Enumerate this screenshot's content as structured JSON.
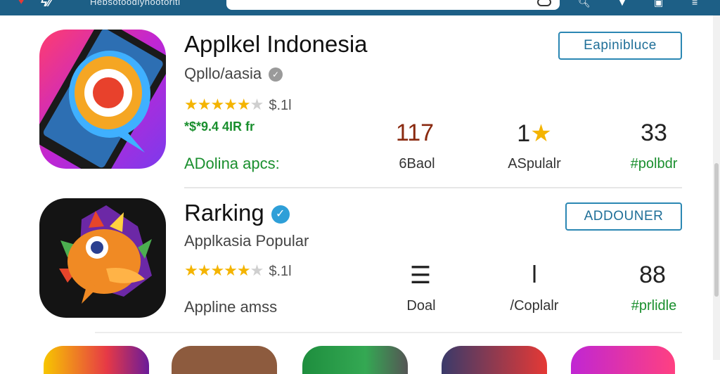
{
  "topbar": {
    "url_text": "Hebsotoodiynootoriti",
    "icons": [
      "heart-icon",
      "search-icon",
      "dropdown-icon",
      "window-icon",
      "menu-icon"
    ]
  },
  "apps": [
    {
      "name": "Applkel Indonesia",
      "subtitle": "Qpllo/aasia",
      "rating_value": "4.5",
      "rating_text": "$.1l",
      "green_line": "*$*9.4 4IR fr",
      "footer": "ADolina apcs:",
      "button": "Eapinibluce",
      "stats": [
        {
          "value": "117",
          "label": "6Baol",
          "value_color": "#8a2a10"
        },
        {
          "value": "1",
          "star": "★",
          "label": "ASpulalr",
          "value_color": "#222"
        },
        {
          "value": "33",
          "label": "#polbdr",
          "value_color": "#222",
          "label_color": "#1a8f2e"
        }
      ]
    },
    {
      "name": "Rarking",
      "subtitle": "Applkasia Popular",
      "rating_value": "4.5",
      "rating_text": "$.1l",
      "footer": "Appline amss",
      "button": "ADDOUNER",
      "stats": [
        {
          "value": "☰",
          "label": "Doal",
          "value_color": "#333"
        },
        {
          "value": "Ɩ",
          "label": "/Coplalr",
          "value_color": "#333"
        },
        {
          "value": "88",
          "label": "#prlidle",
          "value_color": "#222",
          "label_color": "#1a8f2e"
        }
      ]
    }
  ],
  "colors": {
    "topbar": "#1d5f86",
    "accent": "#2b87b3",
    "star": "#f4b400",
    "green": "#1a8f2e"
  }
}
